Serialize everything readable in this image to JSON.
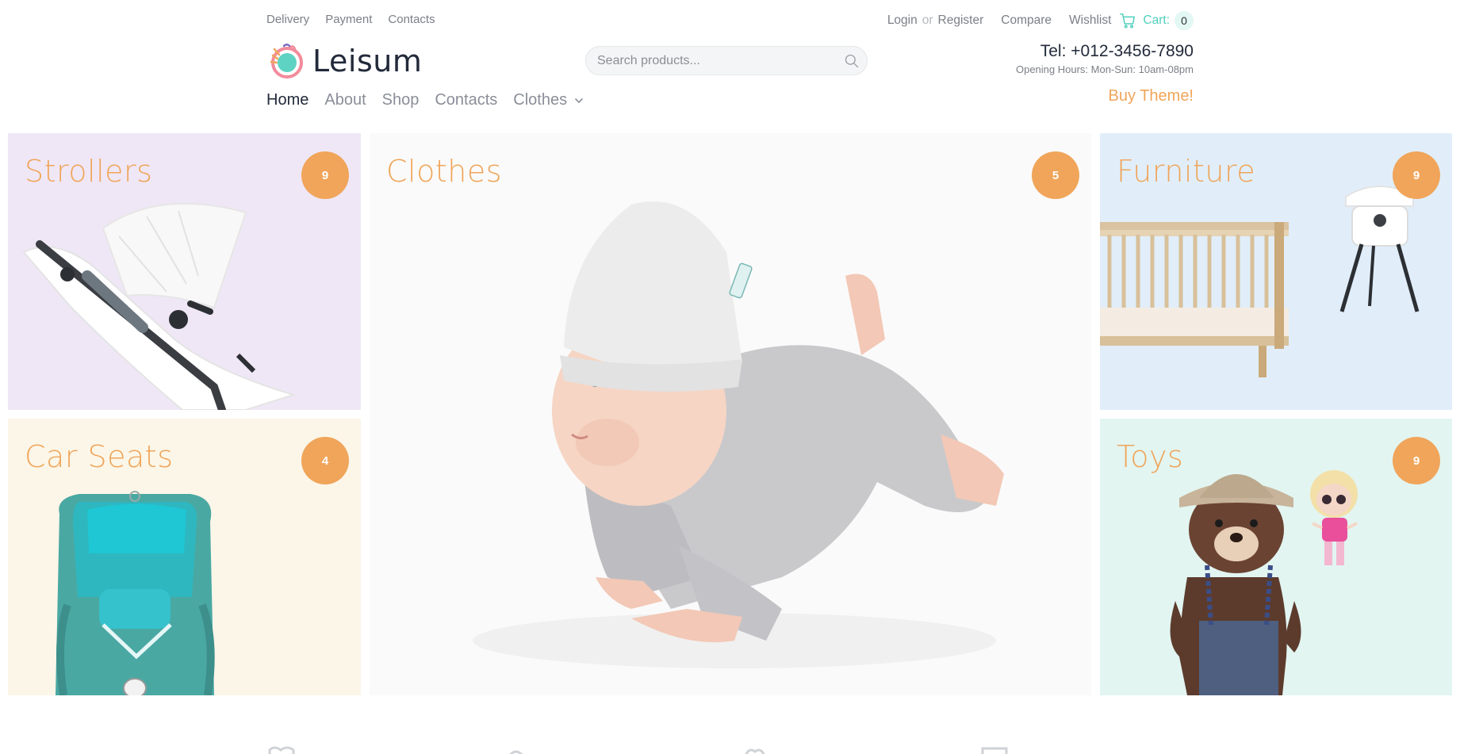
{
  "topbar": {
    "links": [
      "Delivery",
      "Payment",
      "Contacts"
    ],
    "login": "Login",
    "or": "or",
    "register": "Register",
    "compare": "Compare",
    "wishlist": "Wishlist",
    "cart_label": "Cart:",
    "cart_count": "0"
  },
  "brand": {
    "name": "Leisum"
  },
  "search": {
    "placeholder": "Search products..."
  },
  "contact": {
    "tel": "Tel: +012-3456-7890",
    "hours": "Opening Hours: Mon-Sun: 10am-08pm",
    "buy_theme": "Buy Theme!"
  },
  "nav": {
    "items": [
      "Home",
      "About",
      "Shop",
      "Contacts"
    ],
    "dropdown_label": "Clothes",
    "active": "Home"
  },
  "categories": [
    {
      "title": "Strollers",
      "count": "9"
    },
    {
      "title": "Car Seats",
      "count": "4"
    },
    {
      "title": "Clothes",
      "count": "5"
    },
    {
      "title": "Furniture",
      "count": "9"
    },
    {
      "title": "Toys",
      "count": "9"
    }
  ],
  "colors": {
    "accent_orange": "#f0a55a",
    "accent_teal": "#4fcfbd",
    "text_dark": "#222a3a",
    "text_muted": "#7b7f86"
  },
  "icons": {
    "logo": "logo-icon",
    "cart": "cart-icon",
    "search": "search-icon",
    "dropdown": "chevron-down-icon"
  }
}
